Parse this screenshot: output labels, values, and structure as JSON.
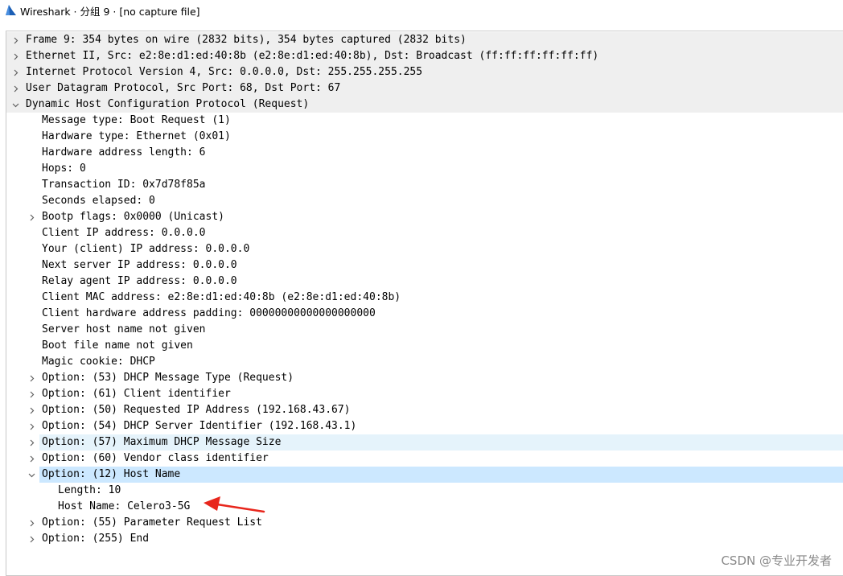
{
  "window": {
    "title": "Wireshark · 分组 9 · [no capture file]",
    "app_icon": "wireshark-shark-fin-icon"
  },
  "tree": [
    {
      "level": 0,
      "expander": "collapsed",
      "text": "Frame 9: 354 bytes on wire (2832 bits), 354 bytes captured (2832 bits)"
    },
    {
      "level": 0,
      "expander": "collapsed",
      "text": "Ethernet II, Src: e2:8e:d1:ed:40:8b (e2:8e:d1:ed:40:8b), Dst: Broadcast (ff:ff:ff:ff:ff:ff)"
    },
    {
      "level": 0,
      "expander": "collapsed",
      "text": "Internet Protocol Version 4, Src: 0.0.0.0, Dst: 255.255.255.255"
    },
    {
      "level": 0,
      "expander": "collapsed",
      "text": "User Datagram Protocol, Src Port: 68, Dst Port: 67"
    },
    {
      "level": 0,
      "expander": "expanded",
      "text": "Dynamic Host Configuration Protocol (Request)"
    },
    {
      "level": 1,
      "expander": "none",
      "text": "Message type: Boot Request (1)"
    },
    {
      "level": 1,
      "expander": "none",
      "text": "Hardware type: Ethernet (0x01)"
    },
    {
      "level": 1,
      "expander": "none",
      "text": "Hardware address length: 6"
    },
    {
      "level": 1,
      "expander": "none",
      "text": "Hops: 0"
    },
    {
      "level": 1,
      "expander": "none",
      "text": "Transaction ID: 0x7d78f85a"
    },
    {
      "level": 1,
      "expander": "none",
      "text": "Seconds elapsed: 0"
    },
    {
      "level": 1,
      "expander": "collapsed",
      "text": "Bootp flags: 0x0000 (Unicast)"
    },
    {
      "level": 1,
      "expander": "none",
      "text": "Client IP address: 0.0.0.0"
    },
    {
      "level": 1,
      "expander": "none",
      "text": "Your (client) IP address: 0.0.0.0"
    },
    {
      "level": 1,
      "expander": "none",
      "text": "Next server IP address: 0.0.0.0"
    },
    {
      "level": 1,
      "expander": "none",
      "text": "Relay agent IP address: 0.0.0.0"
    },
    {
      "level": 1,
      "expander": "none",
      "text": "Client MAC address: e2:8e:d1:ed:40:8b (e2:8e:d1:ed:40:8b)"
    },
    {
      "level": 1,
      "expander": "none",
      "text": "Client hardware address padding: 00000000000000000000"
    },
    {
      "level": 1,
      "expander": "none",
      "text": "Server host name not given"
    },
    {
      "level": 1,
      "expander": "none",
      "text": "Boot file name not given"
    },
    {
      "level": 1,
      "expander": "none",
      "text": "Magic cookie: DHCP"
    },
    {
      "level": 1,
      "expander": "collapsed",
      "text": "Option: (53) DHCP Message Type (Request)"
    },
    {
      "level": 1,
      "expander": "collapsed",
      "text": "Option: (61) Client identifier"
    },
    {
      "level": 1,
      "expander": "collapsed",
      "text": "Option: (50) Requested IP Address (192.168.43.67)"
    },
    {
      "level": 1,
      "expander": "collapsed",
      "text": "Option: (54) DHCP Server Identifier (192.168.43.1)"
    },
    {
      "level": 1,
      "expander": "collapsed",
      "text": "Option: (57) Maximum DHCP Message Size",
      "state": "hover"
    },
    {
      "level": 1,
      "expander": "collapsed",
      "text": "Option: (60) Vendor class identifier"
    },
    {
      "level": 1,
      "expander": "expanded",
      "text": "Option: (12) Host Name",
      "state": "selected"
    },
    {
      "level": 2,
      "expander": "none",
      "text": "Length: 10"
    },
    {
      "level": 2,
      "expander": "none",
      "text": "Host Name: Celero3-5G",
      "annotation": "red-arrow"
    },
    {
      "level": 1,
      "expander": "collapsed",
      "text": "Option: (55) Parameter Request List"
    },
    {
      "level": 1,
      "expander": "collapsed",
      "text": "Option: (255) End"
    }
  ],
  "annotation": {
    "type": "arrow",
    "color": "#e8261c",
    "points_to": "Host Name: Celero3-5G"
  },
  "watermark": "CSDN @专业开发者",
  "colors": {
    "top_level_row": "#efefef",
    "hover_row": "#e5f3fb",
    "selected_row": "#cce8ff",
    "chevron": "#5f5f5f",
    "arrow": "#e8261c"
  }
}
